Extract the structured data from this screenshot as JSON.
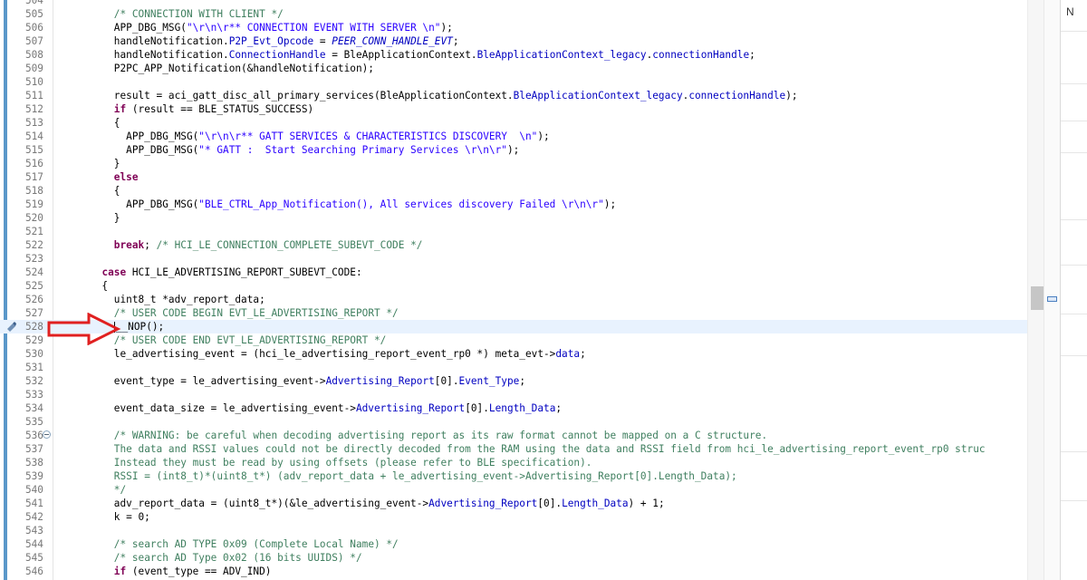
{
  "editor": {
    "lines": [
      {
        "n": "504",
        "t": [
          {
            "x": ""
          }
        ]
      },
      {
        "n": "505",
        "t": [
          {
            "x": "          "
          },
          {
            "x": "/* CONNECTION WITH CLIENT */",
            "c": "c"
          }
        ]
      },
      {
        "n": "506",
        "t": [
          {
            "x": "          APP_DBG_MSG("
          },
          {
            "x": "\"\\r\\n\\r** CONNECTION EVENT WITH SERVER \\n\"",
            "c": "s"
          },
          {
            "x": ");"
          }
        ]
      },
      {
        "n": "507",
        "t": [
          {
            "x": "          handleNotification."
          },
          {
            "x": "P2P_Evt_Opcode",
            "c": "f"
          },
          {
            "x": " = "
          },
          {
            "x": "PEER_CONN_HANDLE_EVT",
            "c": "i"
          },
          {
            "x": ";"
          }
        ]
      },
      {
        "n": "508",
        "t": [
          {
            "x": "          handleNotification."
          },
          {
            "x": "ConnectionHandle",
            "c": "f"
          },
          {
            "x": " = BleApplicationContext."
          },
          {
            "x": "BleApplicationContext_legacy",
            "c": "f"
          },
          {
            "x": "."
          },
          {
            "x": "connectionHandle",
            "c": "f"
          },
          {
            "x": ";"
          }
        ]
      },
      {
        "n": "509",
        "t": [
          {
            "x": "          P2PC_APP_Notification(&handleNotification);"
          }
        ]
      },
      {
        "n": "510",
        "t": [
          {
            "x": ""
          }
        ]
      },
      {
        "n": "511",
        "t": [
          {
            "x": "          result = aci_gatt_disc_all_primary_services(BleApplicationContext."
          },
          {
            "x": "BleApplicationContext_legacy",
            "c": "f"
          },
          {
            "x": "."
          },
          {
            "x": "connectionHandle",
            "c": "f"
          },
          {
            "x": ");"
          }
        ]
      },
      {
        "n": "512",
        "t": [
          {
            "x": "          "
          },
          {
            "x": "if",
            "c": "k"
          },
          {
            "x": " (result == BLE_STATUS_SUCCESS)"
          }
        ]
      },
      {
        "n": "513",
        "t": [
          {
            "x": "          {"
          }
        ]
      },
      {
        "n": "514",
        "t": [
          {
            "x": "            APP_DBG_MSG("
          },
          {
            "x": "\"\\r\\n\\r** GATT SERVICES & CHARACTERISTICS DISCOVERY  \\n\"",
            "c": "s"
          },
          {
            "x": ");"
          }
        ]
      },
      {
        "n": "515",
        "t": [
          {
            "x": "            APP_DBG_MSG("
          },
          {
            "x": "\"* GATT :  Start Searching Primary Services \\r\\n\\r\"",
            "c": "s"
          },
          {
            "x": ");"
          }
        ]
      },
      {
        "n": "516",
        "t": [
          {
            "x": "          }"
          }
        ]
      },
      {
        "n": "517",
        "t": [
          {
            "x": "          "
          },
          {
            "x": "else",
            "c": "k"
          }
        ]
      },
      {
        "n": "518",
        "t": [
          {
            "x": "          {"
          }
        ]
      },
      {
        "n": "519",
        "t": [
          {
            "x": "            APP_DBG_MSG("
          },
          {
            "x": "\"BLE_CTRL_App_Notification(), All services discovery Failed \\r\\n\\r\"",
            "c": "s"
          },
          {
            "x": ");"
          }
        ]
      },
      {
        "n": "520",
        "t": [
          {
            "x": "          }"
          }
        ]
      },
      {
        "n": "521",
        "t": [
          {
            "x": ""
          }
        ]
      },
      {
        "n": "522",
        "t": [
          {
            "x": "          "
          },
          {
            "x": "break",
            "c": "k"
          },
          {
            "x": "; "
          },
          {
            "x": "/* HCI_LE_CONNECTION_COMPLETE_SUBEVT_CODE */",
            "c": "c"
          }
        ]
      },
      {
        "n": "523",
        "t": [
          {
            "x": ""
          }
        ]
      },
      {
        "n": "524",
        "t": [
          {
            "x": "        "
          },
          {
            "x": "case",
            "c": "k"
          },
          {
            "x": " HCI_LE_ADVERTISING_REPORT_SUBEVT_CODE:"
          }
        ]
      },
      {
        "n": "525",
        "t": [
          {
            "x": "        {"
          }
        ]
      },
      {
        "n": "526",
        "t": [
          {
            "x": "          uint8_t *adv_report_data;"
          }
        ]
      },
      {
        "n": "527",
        "t": [
          {
            "x": "          "
          },
          {
            "x": "/* USER CODE BEGIN EVT_LE_ADVERTISING_REPORT */",
            "c": "c"
          }
        ]
      },
      {
        "n": "528",
        "cur": true,
        "t": [
          {
            "x": "          "
          },
          {
            "caret": true
          },
          {
            "x": "__NOP();"
          }
        ]
      },
      {
        "n": "529",
        "t": [
          {
            "x": "          "
          },
          {
            "x": "/* USER CODE END EVT_LE_ADVERTISING_REPORT */",
            "c": "c"
          }
        ]
      },
      {
        "n": "530",
        "t": [
          {
            "x": "          le_advertising_event = (hci_le_advertising_report_event_rp0 *) meta_evt->"
          },
          {
            "x": "data",
            "c": "f"
          },
          {
            "x": ";"
          }
        ]
      },
      {
        "n": "531",
        "t": [
          {
            "x": ""
          }
        ]
      },
      {
        "n": "532",
        "t": [
          {
            "x": "          event_type = le_advertising_event->"
          },
          {
            "x": "Advertising_Report",
            "c": "f"
          },
          {
            "x": "[0]."
          },
          {
            "x": "Event_Type",
            "c": "f"
          },
          {
            "x": ";"
          }
        ]
      },
      {
        "n": "533",
        "t": [
          {
            "x": ""
          }
        ]
      },
      {
        "n": "534",
        "t": [
          {
            "x": "          event_data_size = le_advertising_event->"
          },
          {
            "x": "Advertising_Report",
            "c": "f"
          },
          {
            "x": "[0]."
          },
          {
            "x": "Length_Data",
            "c": "f"
          },
          {
            "x": ";"
          }
        ]
      },
      {
        "n": "535",
        "t": [
          {
            "x": ""
          }
        ]
      },
      {
        "n": "536",
        "fold": true,
        "t": [
          {
            "x": "          "
          },
          {
            "x": "/* WARNING: be careful when decoding advertising report as its raw format cannot be mapped on a C structure.",
            "c": "c"
          }
        ]
      },
      {
        "n": "537",
        "t": [
          {
            "x": "          "
          },
          {
            "x": "The data and RSSI values could not be directly decoded from the RAM using the data and RSSI field from hci_le_advertising_report_event_rp0 struc",
            "c": "c"
          }
        ]
      },
      {
        "n": "538",
        "t": [
          {
            "x": "          "
          },
          {
            "x": "Instead they must be read by using offsets (please refer to BLE specification).",
            "c": "c"
          }
        ]
      },
      {
        "n": "539",
        "t": [
          {
            "x": "          "
          },
          {
            "x": "RSSI = (int8_t)*(uint8_t*) (adv_report_data + le_advertising_event->Advertising_Report[0].Length_Data);",
            "c": "c"
          }
        ]
      },
      {
        "n": "540",
        "t": [
          {
            "x": "          "
          },
          {
            "x": "*/",
            "c": "c"
          }
        ]
      },
      {
        "n": "541",
        "t": [
          {
            "x": "          adv_report_data = (uint8_t*)(&le_advertising_event->"
          },
          {
            "x": "Advertising_Report",
            "c": "f"
          },
          {
            "x": "[0]."
          },
          {
            "x": "Length_Data",
            "c": "f"
          },
          {
            "x": ") + 1;"
          }
        ]
      },
      {
        "n": "542",
        "t": [
          {
            "x": "          k = 0;"
          }
        ]
      },
      {
        "n": "543",
        "t": [
          {
            "x": ""
          }
        ]
      },
      {
        "n": "544",
        "t": [
          {
            "x": "          "
          },
          {
            "x": "/* search AD TYPE 0x09 (Complete Local Name) */",
            "c": "c"
          }
        ]
      },
      {
        "n": "545",
        "t": [
          {
            "x": "          "
          },
          {
            "x": "/* search AD Type 0x02 (16 bits UUIDS) */",
            "c": "c"
          }
        ]
      },
      {
        "n": "546",
        "t": [
          {
            "x": "          "
          },
          {
            "x": "if",
            "c": "k"
          },
          {
            "x": " (event_type == ADV_IND)"
          }
        ]
      }
    ]
  },
  "outline_panel": {
    "label": "N"
  },
  "icons": {
    "bookmark": "bookmark-icon",
    "arrow": "red-arrow-annotation",
    "fold": "fold-collapse-icon"
  },
  "colors": {
    "comment": "#3f7f5f",
    "string": "#2a00ff",
    "keyword": "#7f0055",
    "field": "#0000c0",
    "current_line": "#e8f2fe",
    "annotation_arrow": "#e02020"
  }
}
